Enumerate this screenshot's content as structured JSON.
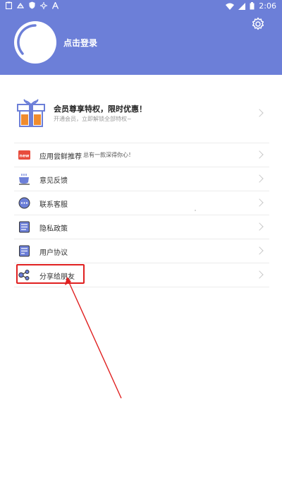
{
  "status_bar": {
    "time": "2:06",
    "left_icons": [
      "clipboard-icon",
      "notification-icon",
      "shield-icon",
      "settings-small-icon",
      "a-icon"
    ],
    "right_icons": [
      "wifi-icon",
      "signal-icon",
      "battery-icon"
    ]
  },
  "header": {
    "login_text": "点击登录",
    "settings_icon": "gear-icon",
    "background_color": "#6c7fd8"
  },
  "vip": {
    "title": "会员尊享特权，限时优惠！",
    "subtitle": "开通会员，立即解锁全部特权~",
    "icon": "gift-icon",
    "accent_color": "#f08c2e"
  },
  "menu": {
    "items": [
      {
        "label": "应用尝鲜推荐",
        "extra": "总有一款深得你心！",
        "icon": "new-badge-icon"
      },
      {
        "label": "意见反馈",
        "extra": "",
        "icon": "coffee-cup-icon"
      },
      {
        "label": "联系客服",
        "extra": "",
        "icon": "chat-bubble-icon"
      },
      {
        "label": "隐私政策",
        "extra": "",
        "icon": "document-icon"
      },
      {
        "label": "用户协议",
        "extra": "",
        "icon": "agreement-icon"
      },
      {
        "label": "分享给朋友",
        "extra": "",
        "icon": "share-icon"
      }
    ]
  },
  "annotation": {
    "highlight_color": "#e02020"
  }
}
